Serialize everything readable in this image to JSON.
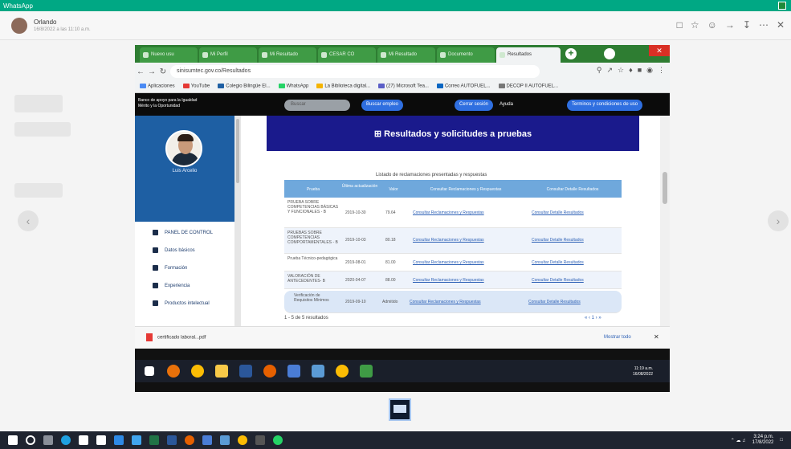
{
  "whatsapp": {
    "app_title": "WhatsApp",
    "contact_name": "Orlando",
    "contact_sub": "16/8/2022 a las 11:10 a.m."
  },
  "browser": {
    "tabs": [
      "Nuevo usu",
      "Mi Perfil",
      "Mi Resultado",
      "CESAR CO",
      "Mi Resultado",
      "Documento",
      "Resultados"
    ],
    "url": "sinisumtec.gov.co/Resultados",
    "bookmarks": [
      "Aplicaciones",
      "YouTube",
      "Colegio Bilingüe El...",
      "WhatsApp",
      "La Biblioteca digital...",
      "(27) Microsoft Tea...",
      "Correo AUTOFUEL...",
      "DECOP II AUTOFUEL..."
    ]
  },
  "site": {
    "header_title": "Banco de apoyo para la Igualdad Mérito y la Oportunidad",
    "search_placeholder": "Buscar",
    "buttons": [
      "Buscar empleo",
      "Cerrar sesión",
      "Terminos y condiciones de uso"
    ],
    "link_ayuda": "Ayuda",
    "user_name": "Luis Arcelio",
    "menu": [
      "PANEL DE CONTROL",
      "Datos básicos",
      "Formación",
      "Experiencia",
      "Productos intelectual"
    ],
    "banner": "⊞ Resultados y solicitudes a pruebas",
    "caption": "Listado de reclamaciones presentadas y respuestas",
    "table_headers": [
      "Prueba",
      "Última actualización",
      "Valor",
      "Consultar Reclamaciones y Respuestas",
      "Consultar Detalle Resultados"
    ],
    "rows": [
      {
        "prueba": "PRUEBA SOBRE COMPETENCIAS BÁSICAS Y FUNCIONALES - B",
        "fecha": "2019-10-30",
        "valor": "79.64",
        "c1": "Consultar Reclamaciones y Respuestas",
        "c2": "Consultar Detalle Resultados"
      },
      {
        "prueba": "PRUEBAS SOBRE COMPETENCIAS COMPORTAMENTALES - B",
        "fecha": "2019-10-03",
        "valor": "80.18",
        "c1": "Consultar Reclamaciones y Respuestas",
        "c2": "Consultar Detalle Resultados"
      },
      {
        "prueba": "Prueba Técnico-pedagógica",
        "fecha": "2019-08-01",
        "valor": "81.00",
        "c1": "Consultar Reclamaciones y Respuestas",
        "c2": "Consultar Detalle Resultados"
      },
      {
        "prueba": "VALORACIÓN DE ANTECEDENTES- B",
        "fecha": "2020-04-07",
        "valor": "88.00",
        "c1": "Consultar Reclamaciones y Respuestas",
        "c2": "Consultar Detalle Resultados"
      },
      {
        "prueba": "Verificación de Requisitos Mínimos",
        "fecha": "2019-09-10",
        "valor": "Admitido",
        "c1": "Consultar Reclamaciones y Respuestas",
        "c2": "Consultar Detalle Resultados"
      }
    ],
    "pager_left": "1 - 5 de 5 resultados",
    "pager_right": "« ‹ 1 › »"
  },
  "downloads": {
    "file": "certificado laboral...pdf",
    "show_all": "Mostrar todo",
    "close": "✕"
  },
  "laptop_clock": {
    "time": "11:19 a.m.",
    "date": "16/08/2022"
  },
  "taskbar_clock": {
    "time": "3:24 p.m.",
    "date": "17/8/2022"
  },
  "colors": {
    "whatsapp_green": "#00a884",
    "chrome_green": "#2e7d32",
    "banner_navy": "#1a1a8c",
    "sidebar_blue": "#1e5fa3",
    "table_header": "#6fa8dc"
  }
}
